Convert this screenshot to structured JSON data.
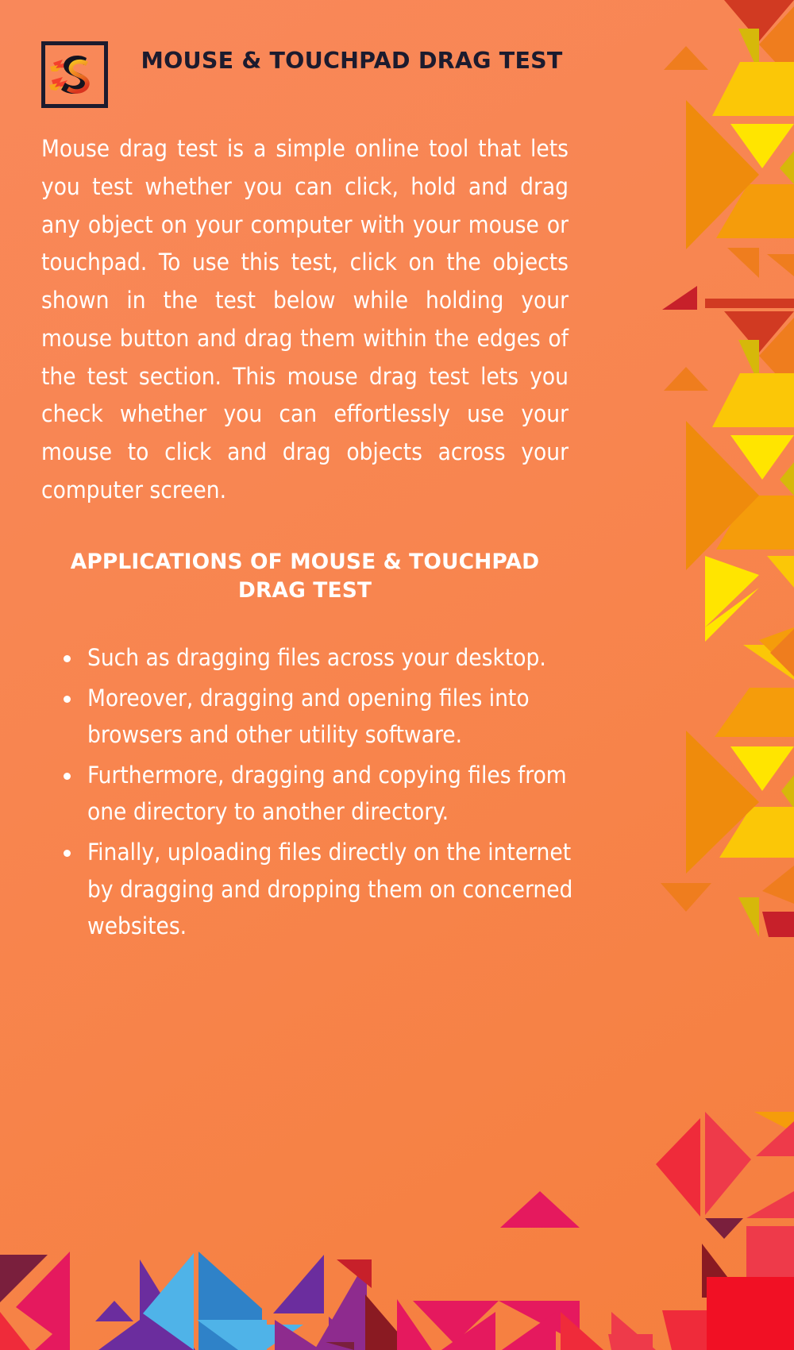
{
  "meta": {
    "background_color": "#f8854f",
    "text_color": "#ffffff",
    "title_color": "#1c1b2e"
  },
  "header": {
    "logo_icon": "flaming-s-logo",
    "title": "MOUSE & TOUCHPAD DRAG TEST"
  },
  "intro": {
    "paragraph": "Mouse drag test is a simple online tool that lets you test whether you can click, hold and drag any object on your computer with your mouse or touchpad. To use this test, click on the objects shown in the test below while holding your mouse button and drag them within the edges of the test section. This mouse drag test lets you check whether you can effortlessly use your mouse to click and drag objects across your computer screen."
  },
  "applications": {
    "heading": "APPLICATIONS OF MOUSE & TOUCHPAD DRAG TEST",
    "items": [
      "Such as dragging files across your desktop.",
      "Moreover, dragging and opening files into browsers and other utility software.",
      "Furthermore, dragging and copying files from one directory to another directory.",
      "Finally, uploading files directly on the internet by dragging and dropping them on concerned websites."
    ]
  },
  "decoration": {
    "right_pattern_name": "triangle-pattern-right",
    "bottom_pattern_name": "triangle-pattern-bottom",
    "palette_warm": [
      "#d13a22",
      "#e8651b",
      "#f59c0b",
      "#fbc707",
      "#ffe500",
      "#f0e10a",
      "#d6b80a",
      "#ef7d1e"
    ],
    "palette_cool": [
      "#e5195e",
      "#7a1f3d",
      "#6b2d9e",
      "#8e2b8e",
      "#3a8fd4",
      "#4fb3e8",
      "#ef2b3a",
      "#c7202a",
      "#8a1a22"
    ]
  }
}
